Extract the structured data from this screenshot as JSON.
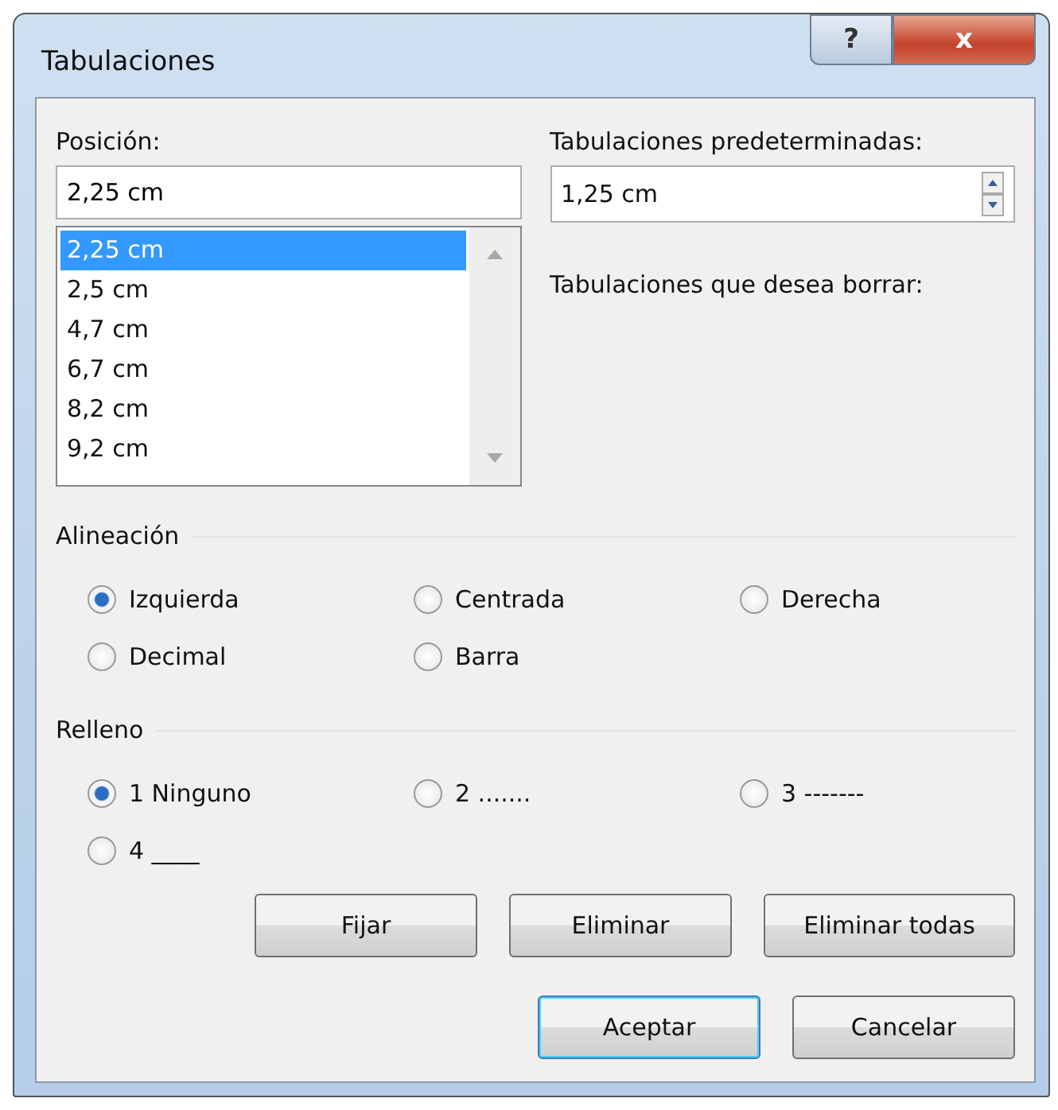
{
  "window": {
    "title": "Tabulaciones",
    "controls": [
      {
        "kind": "help",
        "label": "?"
      },
      {
        "kind": "close",
        "label": "x"
      }
    ]
  },
  "position": {
    "label": "Posición:",
    "value": "2,25 cm",
    "list": [
      {
        "label": "2,25 cm",
        "selected": true
      },
      {
        "label": "2,5 cm",
        "selected": false
      },
      {
        "label": "4,7 cm",
        "selected": false
      },
      {
        "label": "6,7 cm",
        "selected": false
      },
      {
        "label": "8,2 cm",
        "selected": false
      },
      {
        "label": "9,2 cm",
        "selected": false
      }
    ]
  },
  "default_tabs": {
    "label": "Tabulaciones predeterminadas:",
    "value": "1,25 cm"
  },
  "to_clear": {
    "label": "Tabulaciones que desea borrar:"
  },
  "alignment": {
    "title": "Alineación",
    "options": [
      {
        "label": "Izquierda",
        "selected": true
      },
      {
        "label": "Centrada",
        "selected": false
      },
      {
        "label": "Derecha",
        "selected": false
      },
      {
        "label": "Decimal",
        "selected": false
      },
      {
        "label": "Barra",
        "selected": false
      }
    ]
  },
  "leader": {
    "title": "Relleno",
    "options": [
      {
        "label": "1 Ninguno",
        "selected": true
      },
      {
        "label": "2 .......",
        "selected": false
      },
      {
        "label": "3 -------",
        "selected": false
      },
      {
        "label": "4 ____",
        "selected": false
      }
    ]
  },
  "action_buttons": [
    "Fijar",
    "Eliminar",
    "Eliminar todas"
  ],
  "dialog_buttons": [
    {
      "label": "Aceptar",
      "default": true
    },
    {
      "label": "Cancelar",
      "default": false
    }
  ]
}
